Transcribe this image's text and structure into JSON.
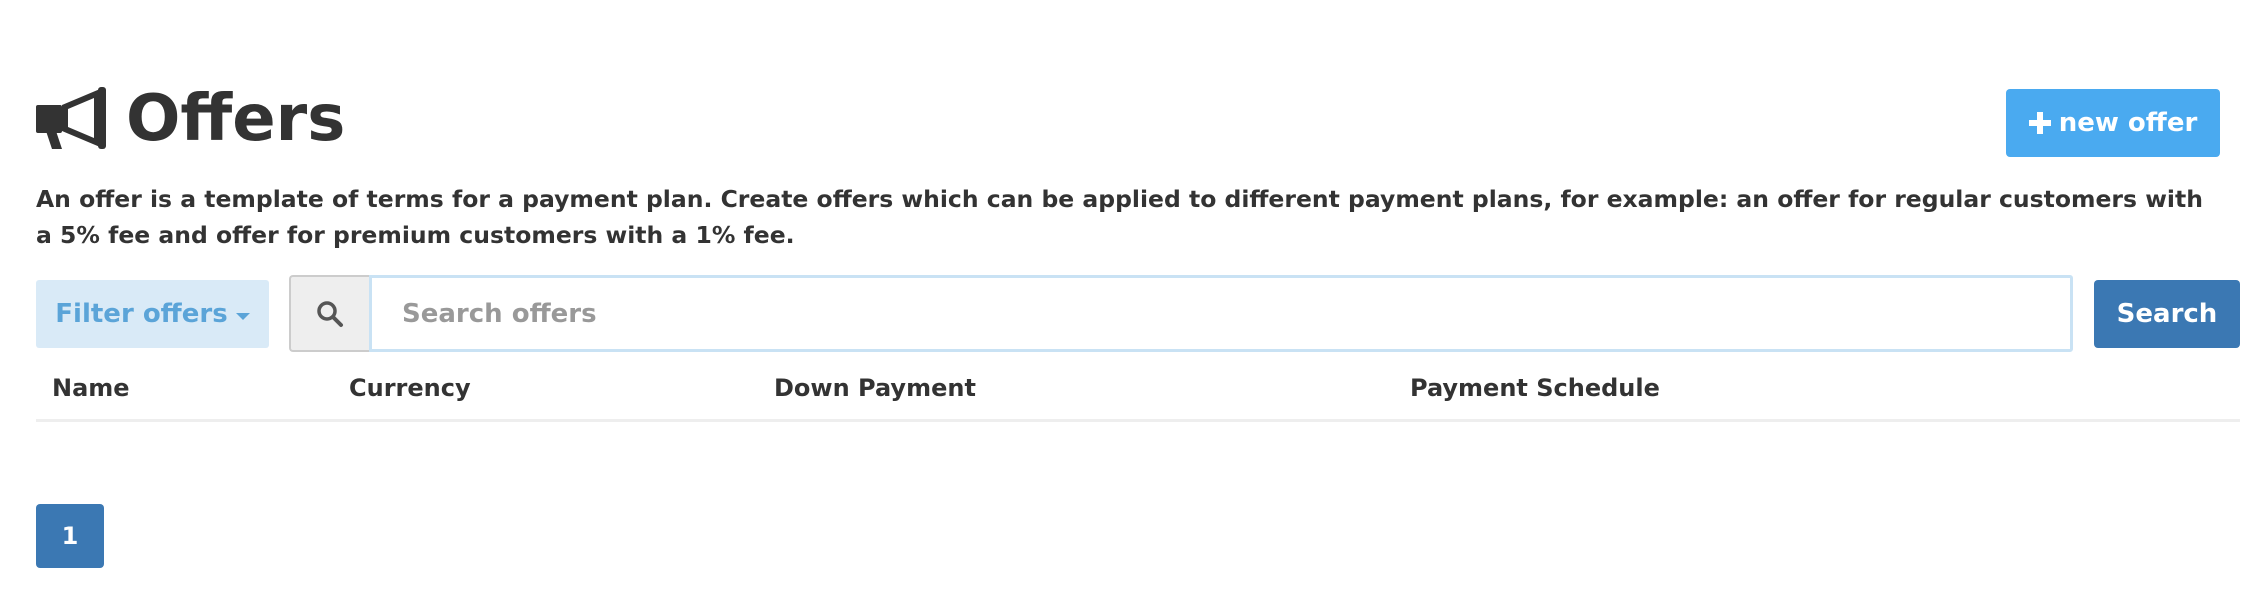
{
  "header": {
    "title": "Offers",
    "icon": "megaphone-icon",
    "new_offer_label": "new offer",
    "new_offer_icon": "plus-icon"
  },
  "description": "An offer is a template of terms for a payment plan. Create offers which can be applied to different payment plans, for example: an offer for regular customers with a 5% fee and offer for premium customers with a 1% fee.",
  "filter": {
    "label": "Filter offers",
    "icon": "caret-down-icon"
  },
  "search": {
    "icon": "search-icon",
    "value": "",
    "placeholder": "Search offers",
    "button_label": "Search"
  },
  "table": {
    "columns": [
      "Name",
      "Currency",
      "Down Payment",
      "Payment Schedule"
    ],
    "rows": []
  },
  "pagination": {
    "pages": [
      "1"
    ],
    "current": "1"
  },
  "colors": {
    "primary": "#3b78b3",
    "accent": "#4aaaf0",
    "filter_bg": "#d9eaf7",
    "filter_text": "#5ba4d8",
    "text": "#333333"
  }
}
